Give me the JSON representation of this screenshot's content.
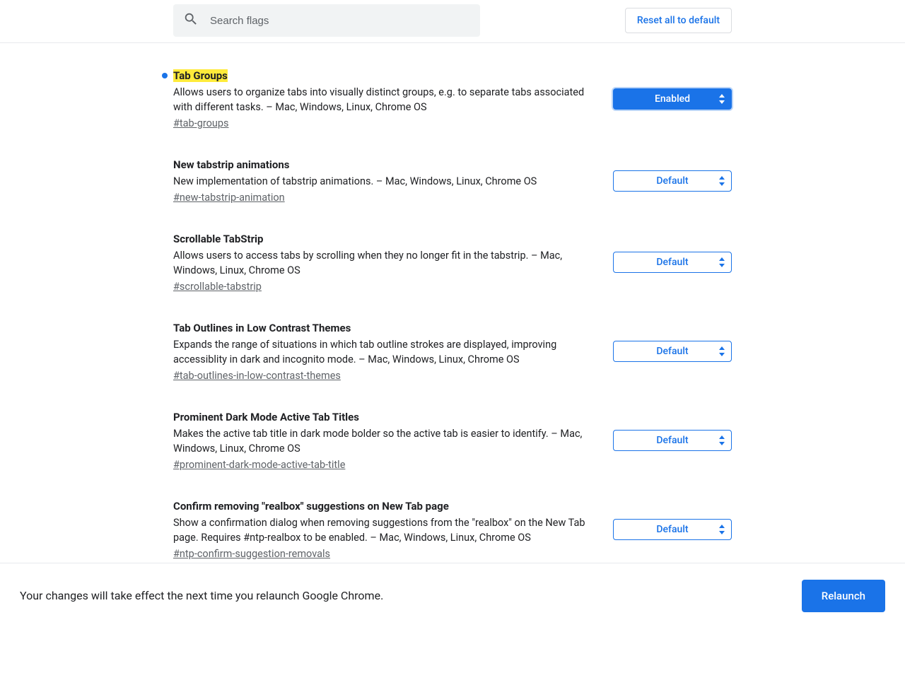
{
  "search": {
    "placeholder": "Search flags"
  },
  "reset_label": "Reset all to default",
  "flags": [
    {
      "title": "Tab Groups",
      "highlighted": true,
      "modified": true,
      "desc": "Allows users to organize tabs into visually distinct groups, e.g. to separate tabs associated with different tasks. – Mac, Windows, Linux, Chrome OS",
      "hash": "#tab-groups",
      "select": "Enabled",
      "select_active": true
    },
    {
      "title": "New tabstrip animations",
      "highlighted": false,
      "modified": false,
      "desc": "New implementation of tabstrip animations. – Mac, Windows, Linux, Chrome OS",
      "hash": "#new-tabstrip-animation",
      "select": "Default",
      "select_active": false
    },
    {
      "title": "Scrollable TabStrip",
      "highlighted": false,
      "modified": false,
      "desc": "Allows users to access tabs by scrolling when they no longer fit in the tabstrip. – Mac, Windows, Linux, Chrome OS",
      "hash": "#scrollable-tabstrip",
      "select": "Default",
      "select_active": false
    },
    {
      "title": "Tab Outlines in Low Contrast Themes",
      "highlighted": false,
      "modified": false,
      "desc": "Expands the range of situations in which tab outline strokes are displayed, improving accessiblity in dark and incognito mode. – Mac, Windows, Linux, Chrome OS",
      "hash": "#tab-outlines-in-low-contrast-themes",
      "select": "Default",
      "select_active": false
    },
    {
      "title": "Prominent Dark Mode Active Tab Titles",
      "highlighted": false,
      "modified": false,
      "desc": "Makes the active tab title in dark mode bolder so the active tab is easier to identify. – Mac, Windows, Linux, Chrome OS",
      "hash": "#prominent-dark-mode-active-tab-title",
      "select": "Default",
      "select_active": false
    },
    {
      "title": "Confirm removing \"realbox\" suggestions on New Tab page",
      "highlighted": false,
      "modified": false,
      "desc": "Show a confirmation dialog when removing suggestions from the \"realbox\" on the New Tab page. Requires #ntp-realbox to be enabled. – Mac, Windows, Linux, Chrome OS",
      "hash": "#ntp-confirm-suggestion-removals",
      "select": "Default",
      "select_active": false
    }
  ],
  "footer": {
    "message": "Your changes will take effect the next time you relaunch Google Chrome.",
    "relaunch": "Relaunch"
  }
}
